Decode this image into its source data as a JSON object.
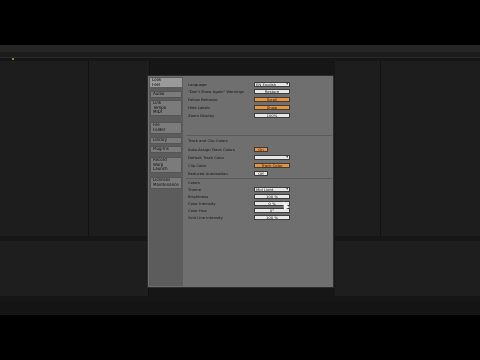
{
  "nav": {
    "group1": [
      "Look",
      "Feel"
    ],
    "group2": [
      "Audio"
    ],
    "group3": [
      "Link",
      "Tempo",
      "MIDI"
    ],
    "group4": [
      "File",
      "Folder"
    ],
    "group5": [
      "Library"
    ],
    "group6": [
      "Plug-Ins"
    ],
    "group7": [
      "Record",
      "Warp",
      "Launch"
    ],
    "group8": [
      "Licenses",
      "Maintenance"
    ]
  },
  "settings": {
    "language_label": "Language",
    "language_value": "EN English",
    "dont_show_label": "\"Don't Show Again\" Warnings",
    "dont_show_value": "Restore",
    "follow_behavior_label": "Follow Behavior",
    "follow_behavior_value": "Scroll",
    "hide_labels_label": "Hide Labels",
    "hide_labels_value": "Show",
    "zoom_display_label": "Zoom Display",
    "zoom_display_value": "100%"
  },
  "sections": {
    "track_clip": "Track and Clip Colors",
    "colors": "Colors"
  },
  "track": {
    "auto_assign_label": "Auto-Assign Track Colors",
    "auto_assign_value": "On",
    "default_color_label": "Default Track Color",
    "clip_color_label": "Clip Color",
    "clip_color_value": "Track Color",
    "reduced_auto_label": "Reduced Automation",
    "reduced_auto_value": "Off"
  },
  "colors": {
    "theme_label": "Theme",
    "theme_value": "Mid Light",
    "brightness_label": "Brightness",
    "brightness_value": "100 %",
    "color_intensity_label": "Color Intensity",
    "color_intensity_value": "0 %",
    "color_hue_label": "Color Hue",
    "color_hue_value": "0°",
    "grid_intensity_label": "Grid Line Intensity",
    "grid_intensity_value": "100 %"
  },
  "ui_colors": {
    "accent_orange": "#e9923a",
    "dialog_bg": "#6f6f6f",
    "sidebar_bg": "#5c5c5c"
  }
}
